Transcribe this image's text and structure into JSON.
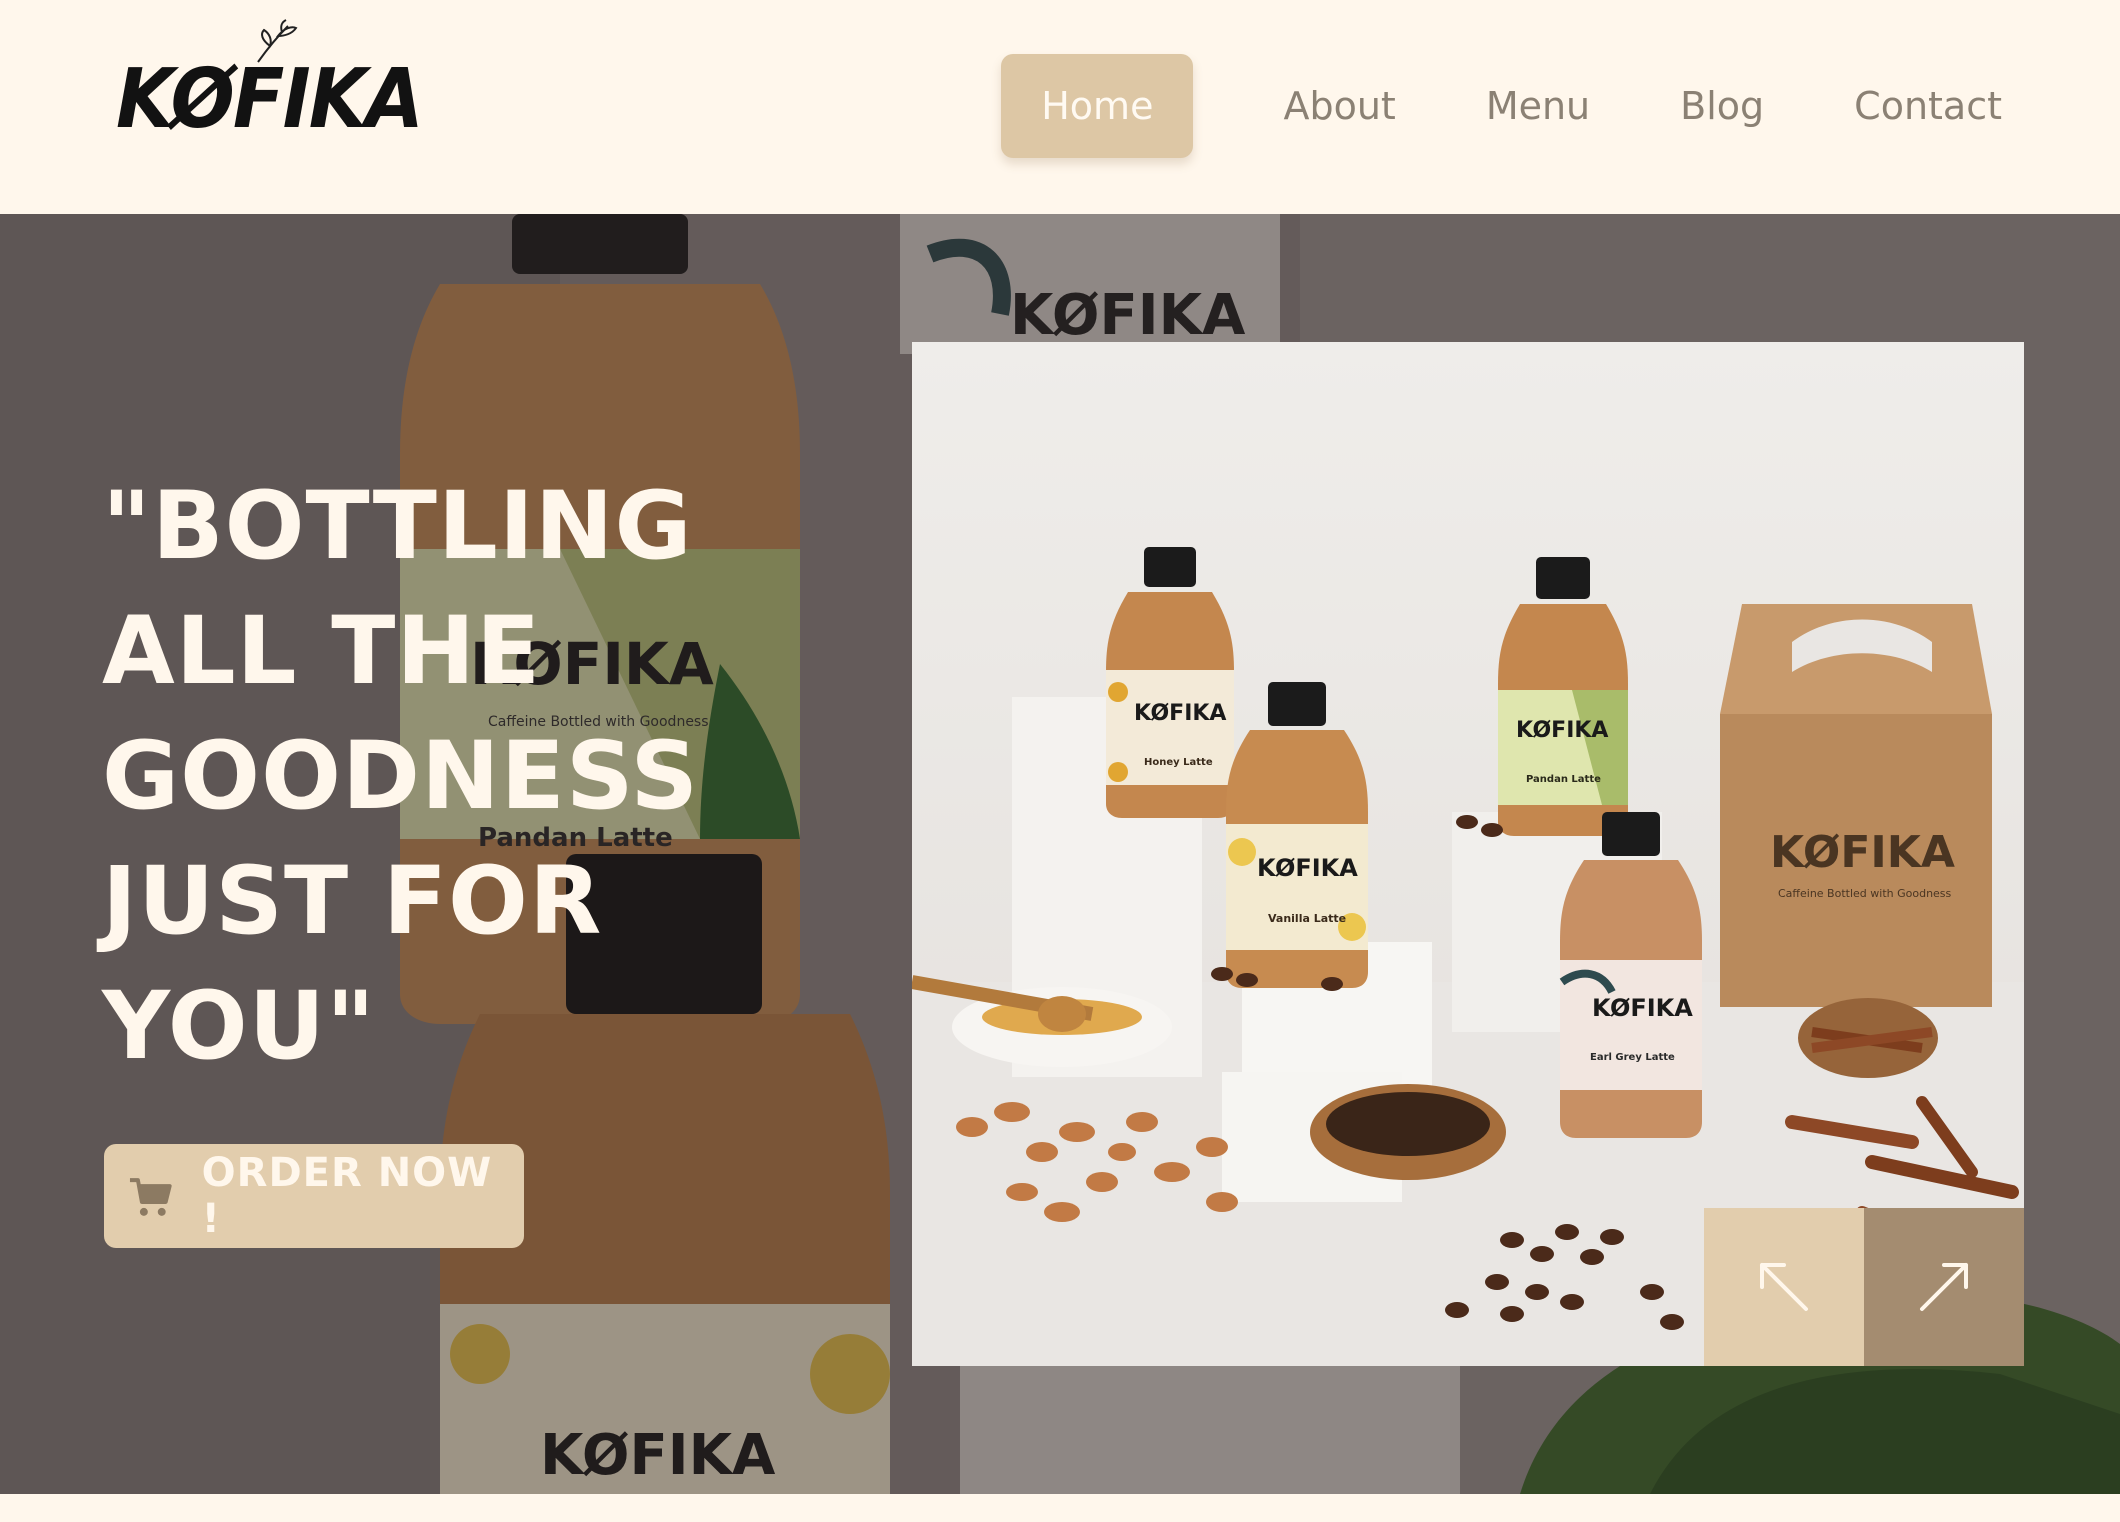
{
  "brand": {
    "logo_text": "KØFIKA"
  },
  "nav": {
    "items": [
      {
        "label": "Home",
        "active": true
      },
      {
        "label": "About",
        "active": false
      },
      {
        "label": "Menu",
        "active": false
      },
      {
        "label": "Blog",
        "active": false
      },
      {
        "label": "Contact",
        "active": false
      }
    ]
  },
  "hero": {
    "headline_lines": [
      "\"BOTTLING",
      "ALL THE",
      "GOODNESS",
      "JUST FOR",
      "YOU\""
    ],
    "order_button": {
      "label": "ORDER NOW !",
      "icon": "cart-icon"
    },
    "background_labels": {
      "brand": "KØFIKA",
      "tagline": "Caffeine Bottled with Goodness",
      "flavor": "Pandan Latte"
    },
    "photo": {
      "bottle_labels": [
        "Honey Latte",
        "Vanilla Latte",
        "Pandan Latte",
        "Earl Grey Latte"
      ],
      "box_brand": "KØFIKA",
      "box_tagline": "Caffeine Bottled with Goodness"
    },
    "slider": {
      "prev_icon": "arrow-up-left-icon",
      "next_icon": "arrow-up-right-icon"
    }
  },
  "colors": {
    "cream": "#fff7ec",
    "tan": "#ddc7a5",
    "mocha": "#a48c70",
    "nav_text": "#8b8174"
  }
}
